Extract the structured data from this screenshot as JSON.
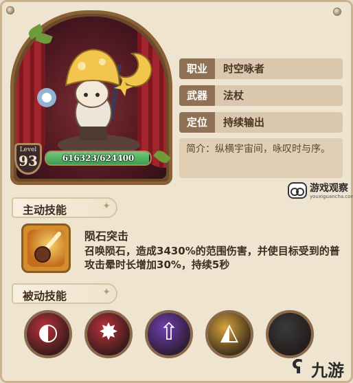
{
  "character": {
    "level_label": "Level",
    "level": "93",
    "hp_text": "616323/624400",
    "hp_fraction": 0.987
  },
  "info": {
    "rows": [
      {
        "label": "职业",
        "value": "时空咏者"
      },
      {
        "label": "武器",
        "value": "法杖"
      },
      {
        "label": "定位",
        "value": "持续输出"
      }
    ],
    "description": "简介：纵横宇宙间，咏叹时与序。"
  },
  "watermark": {
    "title": "游戏观察",
    "url": "youxiguancha.com"
  },
  "active_skill": {
    "section_title": "主动技能",
    "name": "陨石突击",
    "description": "召唤陨石，造成3430%的范围伤害，并使目标受到的普攻击晕时长增加30%，持续5秒"
  },
  "passive_skills": {
    "section_title": "被动技能",
    "icons": [
      {
        "name": "crimson-slash-icon",
        "color": "#b6333a"
      },
      {
        "name": "flame-claw-icon",
        "color": "#b6333a"
      },
      {
        "name": "arrow-up-icon",
        "color": "#6f3fb2"
      },
      {
        "name": "pizza-slice-icon",
        "color": "#d6a43a"
      },
      {
        "name": "locked-slot-icon",
        "color": "#3a3a3a"
      }
    ]
  },
  "corner_logo": {
    "text": "九游"
  }
}
